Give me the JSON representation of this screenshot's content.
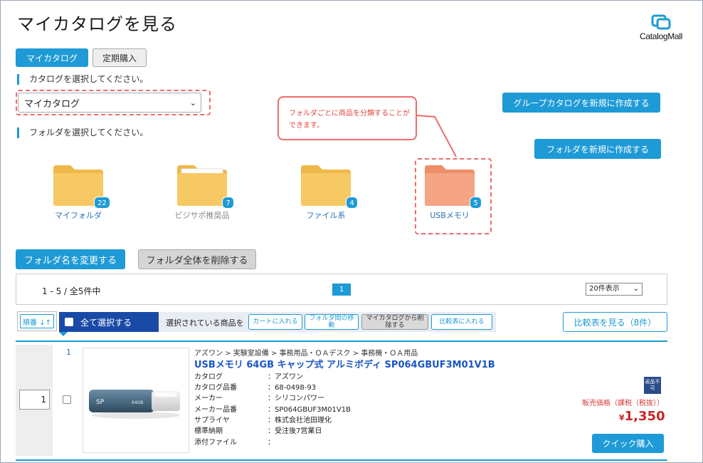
{
  "header": {
    "title": "マイカタログを見る",
    "logo_text": "CatalogMall"
  },
  "tabs": [
    {
      "label": "マイカタログ",
      "active": true
    },
    {
      "label": "定期購入",
      "active": false
    }
  ],
  "catalog": {
    "prompt": "カタログを選択してください。",
    "selected": "マイカタログ"
  },
  "folder_section": {
    "prompt": "フォルダを選択してください。"
  },
  "callout": {
    "text": "フォルダごとに商品を分類することができます。"
  },
  "actions": {
    "new_group_catalog": "グループカタログを新規に作成する",
    "new_folder": "フォルダを新規に作成する",
    "rename_folder": "フォルダ名を変更する",
    "delete_all_folders": "フォルダ全体を削除する"
  },
  "folders": [
    {
      "name": "マイフォルダ",
      "count": "22"
    },
    {
      "name": "ビジサポ推奨品",
      "count": "7"
    },
    {
      "name": "ファイル系",
      "count": "4"
    },
    {
      "name": "USBメモリ",
      "count": "5"
    }
  ],
  "pager": {
    "count_text": "1 - 5 / 全5件中",
    "current_page": "1",
    "per_page": "20件表示"
  },
  "list_toolbar": {
    "sort_label": "順番 ↓↑",
    "select_all": "全て選択する",
    "selected_items_label": "選択されている商品を",
    "bulk_buttons": [
      "カートに入れる",
      "フォルダ間の移動",
      "マイカタログから削除する",
      "比較表に入れる"
    ],
    "compare_view": "比較表を見る（8件）"
  },
  "product": {
    "index": "1",
    "quantity": "1",
    "breadcrumb": "アズワン > 実験室設備 > 事務用品・ＯＡデスク > 事務機・ＯＡ用品",
    "title": "USBメモリ 64GB キャップ式 アルミボディ SP064GBUF3M01V1B",
    "specs": [
      {
        "key": "カタログ",
        "value": "：アズワン"
      },
      {
        "key": "カタログ品番",
        "value": "：68-0498-93"
      },
      {
        "key": "メーカー",
        "value": "：シリコンパワー"
      },
      {
        "key": "メーカー品番",
        "value": "：SP064GBUF3M01V1B"
      },
      {
        "key": "サプライヤ",
        "value": "：株式会社池田理化"
      },
      {
        "key": "標準納期",
        "value": "：受注後7営業日"
      },
      {
        "key": "添付ファイル",
        "value": "："
      }
    ],
    "no_return_badge": "返品不可",
    "price_label": "販売価格（課税（税抜））",
    "price_currency": "¥",
    "price": "1,350",
    "quick_buy": "クイック購入",
    "image_brand": "SP",
    "image_capacity": "64GB"
  },
  "colors": {
    "accent": "#1e9ad6",
    "dark_blue": "#1a4aa8",
    "callout_red": "#ef6b6b",
    "price_red": "#c62828",
    "folder_yellow": "#f7c965",
    "folder_highlight": "#f5a584"
  }
}
